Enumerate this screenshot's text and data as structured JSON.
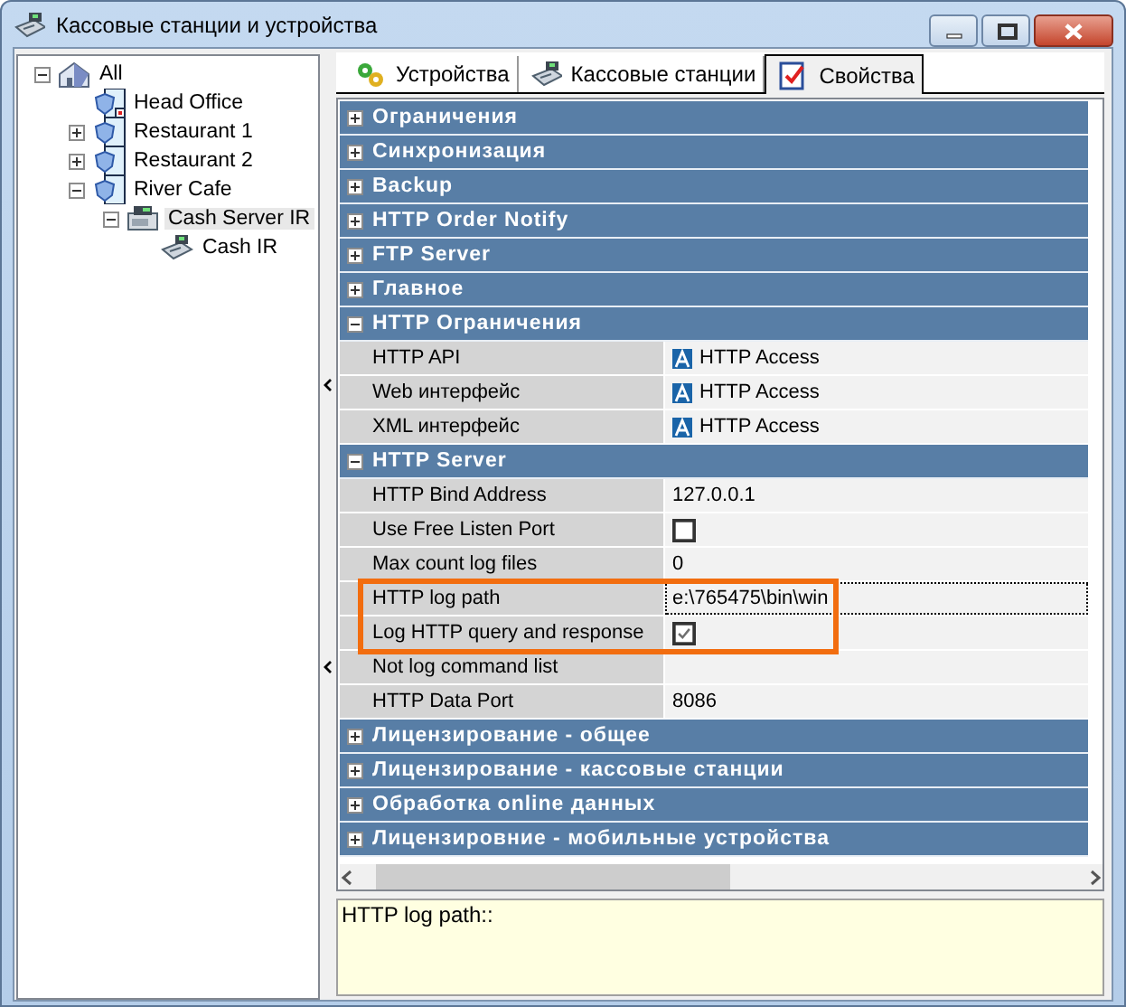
{
  "window": {
    "title": "Кассовые станции и устройства"
  },
  "tree": [
    {
      "label": "All",
      "kind": "house",
      "expanded": true,
      "selected": false,
      "marked": false,
      "children": [
        {
          "label": "Head Office",
          "kind": "site",
          "selected": false,
          "marked": true
        },
        {
          "label": "Restaurant 1",
          "kind": "site",
          "expanded": false,
          "selected": false,
          "marked": false
        },
        {
          "label": "Restaurant 2",
          "kind": "site",
          "expanded": false,
          "selected": false,
          "marked": false
        },
        {
          "label": "River Cafe",
          "kind": "site",
          "expanded": true,
          "selected": false,
          "marked": false,
          "children": [
            {
              "label": "Cash Server IR",
              "kind": "server",
              "expanded": true,
              "selected": true,
              "marked": false,
              "children": [
                {
                  "label": "Cash IR",
                  "kind": "register",
                  "selected": false,
                  "marked": false
                }
              ]
            }
          ]
        }
      ]
    }
  ],
  "tabs": [
    {
      "label": "Устройства",
      "kind": "devices",
      "selected": false
    },
    {
      "label": "Кассовые станции",
      "kind": "register",
      "selected": false
    },
    {
      "label": "Свойства",
      "kind": "properties",
      "selected": true
    }
  ],
  "sections": [
    {
      "title": "Ограничения",
      "expanded": false
    },
    {
      "title": "Синхронизация",
      "expanded": false
    },
    {
      "title": "Backup",
      "expanded": false
    },
    {
      "title": "HTTP Order Notify",
      "expanded": false
    },
    {
      "title": "FTP Server",
      "expanded": false
    },
    {
      "title": "Главное",
      "expanded": false
    },
    {
      "title": "HTTP Ограничения",
      "expanded": true,
      "rows": [
        {
          "name": "HTTP API",
          "kind": "access",
          "value": "HTTP Access",
          "selected": false,
          "highlighted": false
        },
        {
          "name": "Web интерфейс",
          "kind": "access",
          "value": "HTTP Access",
          "selected": false,
          "highlighted": false
        },
        {
          "name": "XML интерфейс",
          "kind": "access",
          "value": "HTTP Access",
          "selected": false,
          "highlighted": false
        }
      ]
    },
    {
      "title": "HTTP Server",
      "expanded": true,
      "rows": [
        {
          "name": "HTTP Bind Address",
          "kind": "text",
          "value": "127.0.0.1",
          "selected": false,
          "highlighted": false
        },
        {
          "name": "Use Free Listen Port",
          "kind": "checkbox",
          "checked": false,
          "selected": false,
          "highlighted": false
        },
        {
          "name": "Max count log files",
          "kind": "text",
          "value": "0",
          "selected": false,
          "highlighted": false
        },
        {
          "name": "HTTP log path",
          "kind": "text",
          "value": "e:\\765475\\bin\\win",
          "selected": true,
          "highlighted": true
        },
        {
          "name": "Log HTTP query and response",
          "kind": "checkbox",
          "checked": true,
          "selected": false,
          "highlighted": true
        },
        {
          "name": "Not log command list",
          "kind": "text",
          "selected": false,
          "highlighted": false
        },
        {
          "name": "HTTP Data Port",
          "kind": "text",
          "value": "8086",
          "selected": false,
          "highlighted": false
        }
      ]
    },
    {
      "title": "Лицензирование - общее",
      "expanded": false
    },
    {
      "title": "Лицензирование - кассовые станции",
      "expanded": false
    },
    {
      "title": "Обработка online данных",
      "expanded": false
    },
    {
      "title": "Лицензировние - мобильные устройства",
      "expanded": false
    }
  ],
  "description": "HTTP log path::"
}
